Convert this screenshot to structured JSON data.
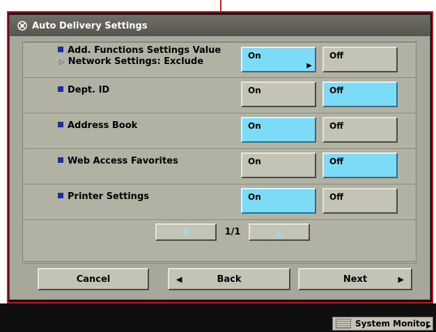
{
  "window": {
    "title": "Auto Delivery Settings",
    "title_icon": "gear-icon"
  },
  "settings": [
    {
      "label": "Add. Functions Settings Value",
      "sub": "Network Settings: Exclude",
      "on_label": "On",
      "off_label": "Off",
      "selected": "on"
    },
    {
      "label": "Dept. ID",
      "on_label": "On",
      "off_label": "Off",
      "selected": "off"
    },
    {
      "label": "Address Book",
      "on_label": "On",
      "off_label": "Off",
      "selected": "on"
    },
    {
      "label": "Web Access Favorites",
      "on_label": "On",
      "off_label": "Off",
      "selected": "off"
    },
    {
      "label": "Printer Settings",
      "on_label": "On",
      "off_label": "Off",
      "selected": "on"
    }
  ],
  "pager": {
    "page": "1/1",
    "down_icon": "triangle-down-icon",
    "up_icon": "triangle-up-icon"
  },
  "footer": {
    "cancel": "Cancel",
    "back": "Back",
    "next": "Next"
  },
  "status": {
    "system_monitor": "System Monitor"
  },
  "colors": {
    "selected": "#7cdcf8",
    "button": "#c4c4b6",
    "panel": "#a8a89a",
    "bullet": "#1a2ea8",
    "frame": "#d0101c"
  }
}
